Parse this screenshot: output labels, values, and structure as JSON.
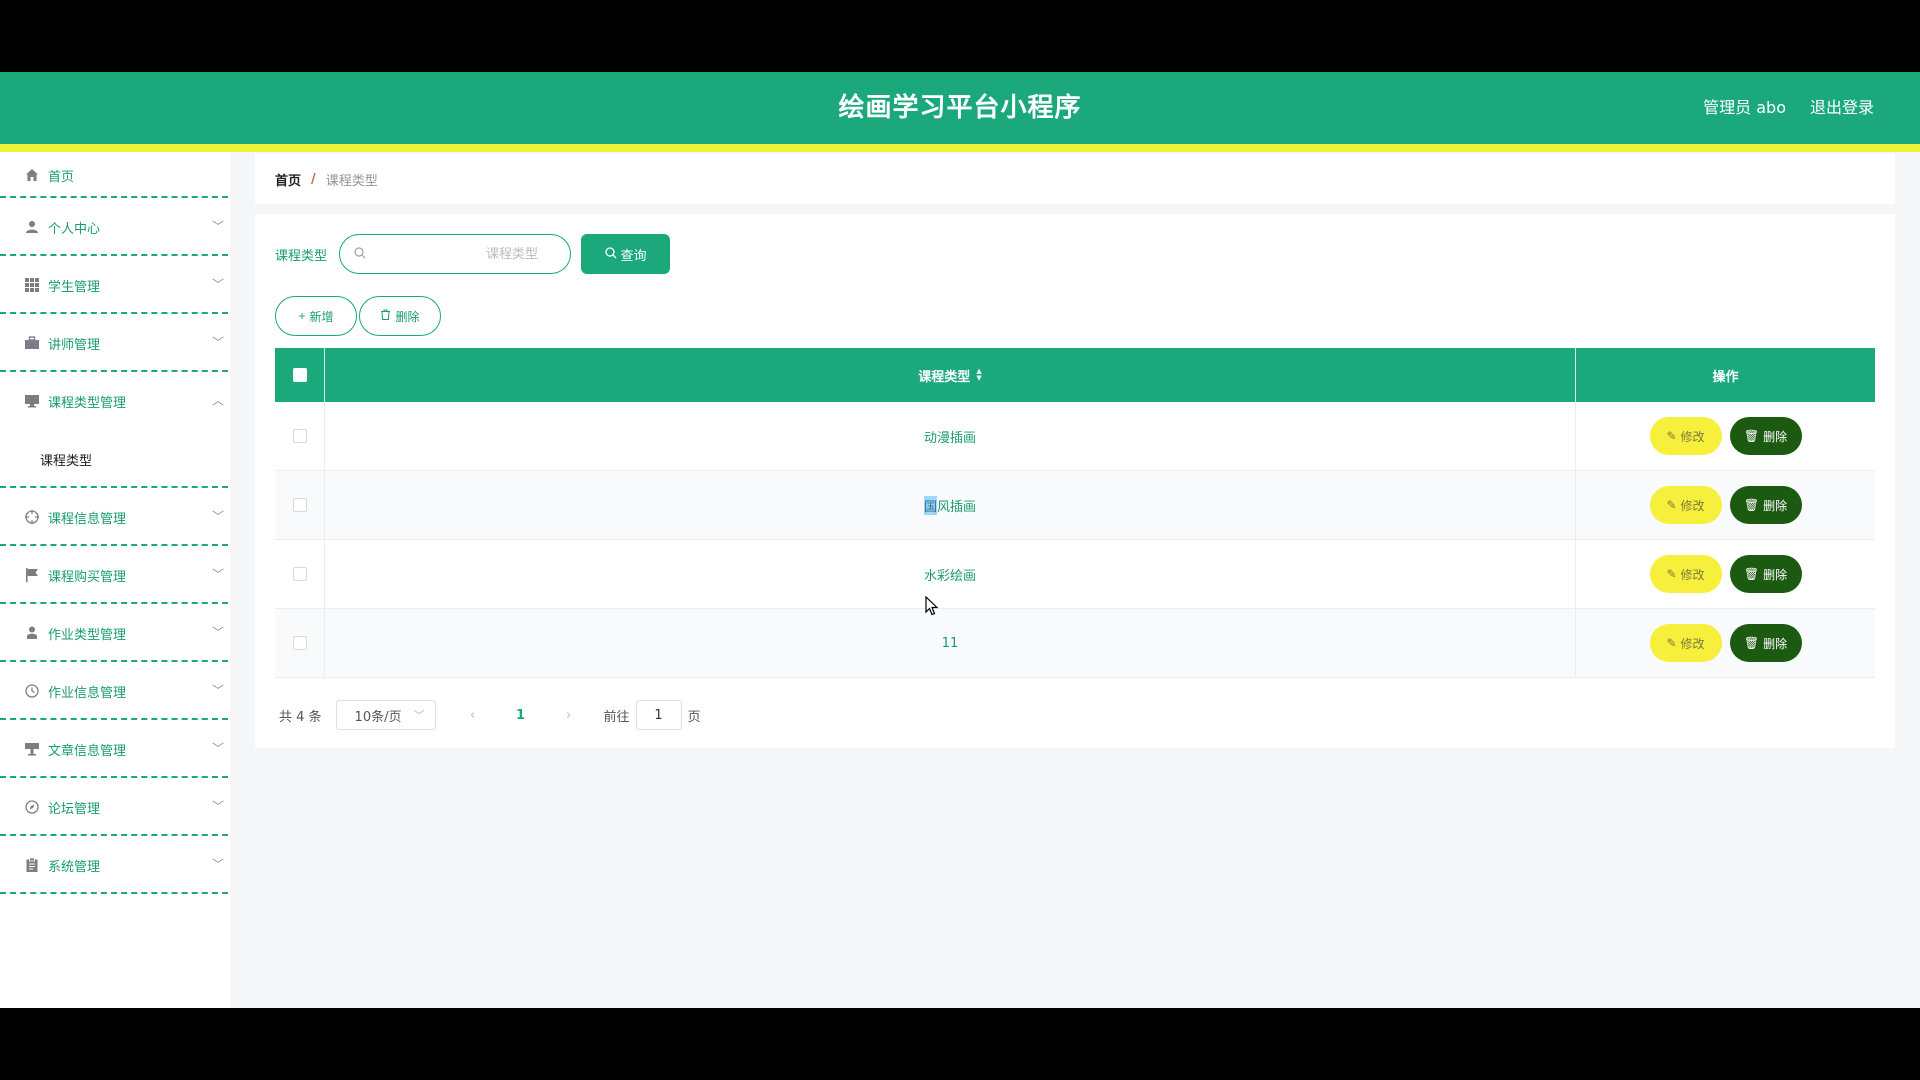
{
  "header": {
    "title": "绘画学习平台小程序",
    "admin_label": "管理员 abo",
    "logout_label": "退出登录"
  },
  "sidebar": {
    "items": [
      {
        "label": "首页",
        "icon": "home-icon"
      },
      {
        "label": "个人中心",
        "icon": "user-icon"
      },
      {
        "label": "学生管理",
        "icon": "grid-icon"
      },
      {
        "label": "讲师管理",
        "icon": "briefcase-icon"
      },
      {
        "label": "课程类型管理",
        "icon": "monitor-icon",
        "submenu": [
          "课程类型"
        ]
      },
      {
        "label": "课程信息管理",
        "icon": "crosshair-icon"
      },
      {
        "label": "课程购买管理",
        "icon": "flag-icon"
      },
      {
        "label": "作业类型管理",
        "icon": "person-icon"
      },
      {
        "label": "作业信息管理",
        "icon": "clock-icon"
      },
      {
        "label": "文章信息管理",
        "icon": "podium-icon"
      },
      {
        "label": "论坛管理",
        "icon": "compass-icon"
      },
      {
        "label": "系统管理",
        "icon": "clipboard-icon"
      }
    ]
  },
  "breadcrumb": {
    "home": "首页",
    "separator": "/",
    "current": "课程类型"
  },
  "search": {
    "label": "课程类型",
    "placeholder": "课程类型",
    "value": "",
    "query_label": "查询"
  },
  "actions": {
    "add_label": "新增",
    "delete_label": "删除"
  },
  "table": {
    "headers": {
      "type": "课程类型",
      "operation": "操作"
    },
    "rows": [
      {
        "type": "动漫插画"
      },
      {
        "type": "国风插画",
        "highlight": "国",
        "rest": "风插画"
      },
      {
        "type": "水彩绘画"
      },
      {
        "type": "11"
      }
    ],
    "edit_label": "修改",
    "delete_label": "删除"
  },
  "pagination": {
    "total": "共 4 条",
    "page_size": "10条/页",
    "current_page": "1",
    "goto_prefix": "前往",
    "goto_value": "1",
    "goto_suffix": "页"
  },
  "colors": {
    "primary": "#1ba97c",
    "accent_yellow": "#eef33a",
    "edit_button": "#f6ef3c",
    "delete_button": "#1c5a12"
  }
}
